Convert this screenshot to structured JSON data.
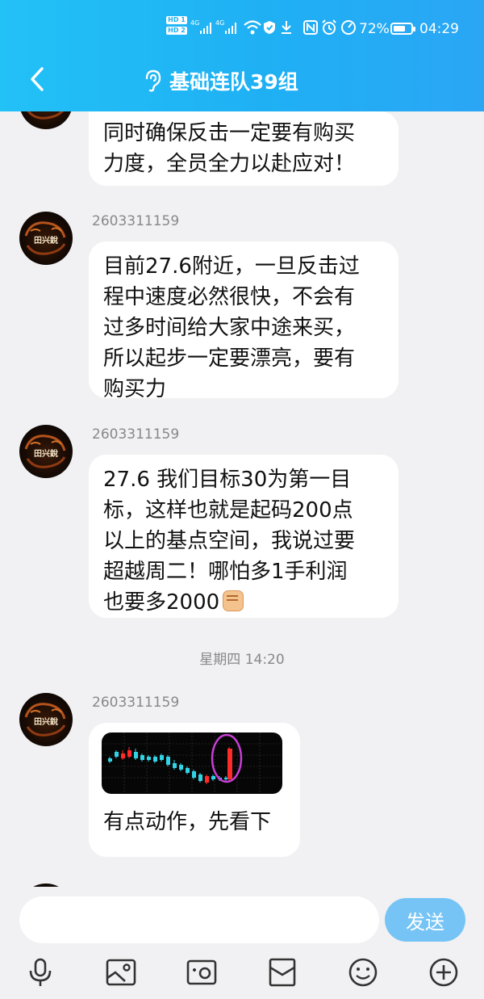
{
  "status_bar": {
    "hd1": "HD 1",
    "hd2": "HD 2",
    "signal1": "4G",
    "signal2": "4G",
    "battery_percent": "72%",
    "battery_level": 0.72,
    "time": "04:29"
  },
  "header": {
    "title": "基础连队39组"
  },
  "messages": [
    {
      "sender": "",
      "lines": [
        "同时确保反击一定要有购买",
        "力度，全员全力以赴应对！"
      ]
    },
    {
      "sender": "2603311159",
      "lines": [
        "目前27.6附近，一旦反击过",
        "程中速度必然很快，不会有",
        "过多时间给大家中途来买，",
        "所以起步一定要漂亮，要有",
        "购买力"
      ]
    },
    {
      "sender": "2603311159",
      "lines": [
        "27.6 我们目标30为第一目",
        "标，这样也就是起码200点",
        "以上的基点空间，我说过要",
        "超越周二！哪怕多1手利润",
        "也要多2000"
      ]
    },
    {
      "sender": "2603311159",
      "caption": "有点动作，先看下"
    }
  ],
  "timestamp": "星期四 14:20",
  "input": {
    "placeholder": "",
    "value": "",
    "send_label": "发送"
  },
  "toolbar": {
    "icons": [
      "microphone-icon",
      "image-icon",
      "camera-icon",
      "red-packet-icon",
      "emoji-icon",
      "plus-icon"
    ]
  },
  "avatar_text": "田兴銳",
  "colors": {
    "header": "#1fb0f4",
    "send_button": "#76c4f5",
    "background": "#f1f1f3"
  }
}
